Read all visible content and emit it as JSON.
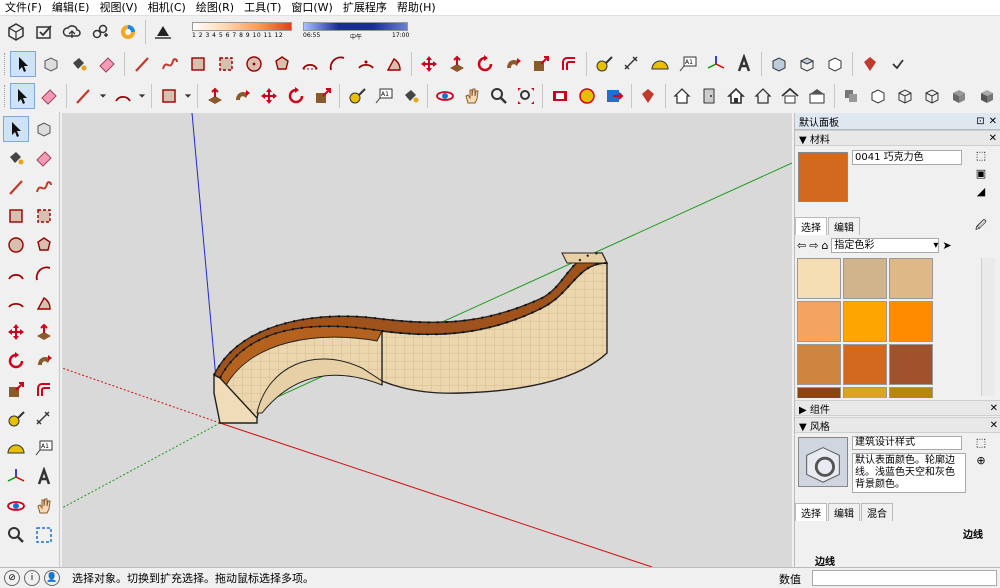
{
  "menu": [
    "文件(F)",
    "编辑(E)",
    "视图(V)",
    "相机(C)",
    "绘图(R)",
    "工具(T)",
    "窗口(W)",
    "扩展程序",
    "帮助(H)"
  ],
  "shadow": {
    "month_numbers": "1 2 3 4 5 6 7 8 9 10 11 12",
    "time_start": "06:55",
    "time_mid": "中午",
    "time_end": "17:00"
  },
  "tray": {
    "title": "默认面板",
    "materials": {
      "header": "材料",
      "name": "0041 巧克力色",
      "tab_select": "选择",
      "tab_edit": "编辑",
      "collection": "指定色彩",
      "color": "#d2691e",
      "swatches": [
        "#f5deb3",
        "#d2b48c",
        "#deb887",
        "#f4a460",
        "#ffa500",
        "#ff8c00",
        "#cd853f",
        "#d2691e",
        "#a0522d",
        "#8b4513",
        "#daa520",
        "#b8860b"
      ]
    },
    "components": {
      "header": "组件"
    },
    "styles": {
      "header": "风格",
      "name": "建筑设计样式",
      "description": "默认表面颜色。轮廓边线。浅蓝色天空和灰色背景颜色。",
      "tab_select": "选择",
      "tab_edit": "编辑",
      "tab_mix": "混合",
      "edge_label": "边线",
      "edge_header": "边线"
    }
  },
  "status": {
    "message": "选择对象。切换到扩充选择。拖动鼠标选择多项。",
    "value_label": "数值"
  }
}
